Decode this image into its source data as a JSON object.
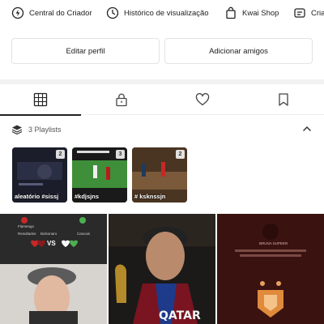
{
  "shortcuts": [
    {
      "label": "Central do Criador",
      "icon": "lightning-circle-icon"
    },
    {
      "label": "Histórico de visualização",
      "icon": "clock-icon"
    },
    {
      "label": "Kwai Shop",
      "icon": "shopping-bag-icon"
    },
    {
      "label": "Cria",
      "icon": "creator-icon"
    }
  ],
  "buttons": {
    "edit_profile": "Editar perfil",
    "add_friends": "Adicionar amigos"
  },
  "tabs": [
    {
      "name": "grid",
      "icon": "grid-icon",
      "active": true
    },
    {
      "name": "private",
      "icon": "lock-icon",
      "active": false
    },
    {
      "name": "likes",
      "icon": "heart-icon",
      "active": false
    },
    {
      "name": "saved",
      "icon": "bookmark-icon",
      "active": false
    }
  ],
  "playlists": {
    "count_label": "3 Playlists",
    "items": [
      {
        "title": "aleatório #sissj",
        "count": "2"
      },
      {
        "title": "#kdjsjns",
        "count": "3"
      },
      {
        "title": "# ksknssjn",
        "count": "2"
      }
    ]
  },
  "grid": {
    "scoreboard_labels": [
      "Flamengo",
      "Resultados",
      "Bolsonaro",
      "Cascais"
    ],
    "vs_label": "VS",
    "shirt_text": "QATAR",
    "panel_text": "BRUNA SUPEER"
  },
  "colors": {
    "accent": "#222222",
    "border": "#e3e3e3",
    "divider": "#f2f2f2"
  }
}
